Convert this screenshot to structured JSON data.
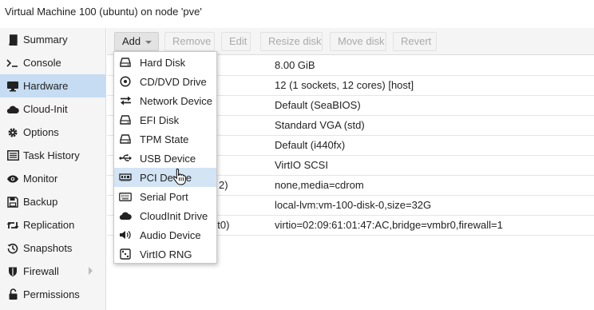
{
  "window": {
    "title": "Virtual Machine 100 (ubuntu) on node 'pve'"
  },
  "sidebar": {
    "items": [
      {
        "label": "Summary",
        "icon": "book-icon"
      },
      {
        "label": "Console",
        "icon": "terminal-icon"
      },
      {
        "label": "Hardware",
        "icon": "desktop-icon",
        "active": true
      },
      {
        "label": "Cloud-Init",
        "icon": "cloud-icon"
      },
      {
        "label": "Options",
        "icon": "gear-icon"
      },
      {
        "label": "Task History",
        "icon": "list-icon"
      },
      {
        "label": "Monitor",
        "icon": "eye-icon"
      },
      {
        "label": "Backup",
        "icon": "floppy-icon"
      },
      {
        "label": "Replication",
        "icon": "retweet-icon"
      },
      {
        "label": "Snapshots",
        "icon": "history-icon"
      },
      {
        "label": "Firewall",
        "icon": "shield-icon",
        "has_submenu": true
      },
      {
        "label": "Permissions",
        "icon": "unlock-icon"
      }
    ]
  },
  "toolbar": {
    "add_label": "Add",
    "remove_label": "Remove",
    "edit_label": "Edit",
    "resize_label": "Resize disk",
    "move_label": "Move disk",
    "revert_label": "Revert"
  },
  "hardware": {
    "rows": [
      {
        "key": "",
        "value": "8.00 GiB"
      },
      {
        "key": "",
        "value": "12 (1 sockets, 12 cores) [host]"
      },
      {
        "key": "",
        "value": "Default (SeaBIOS)"
      },
      {
        "key": "",
        "value": "Standard VGA (std)"
      },
      {
        "key": "",
        "value": "Default (i440fx)"
      },
      {
        "key": "",
        "value": "VirtIO SCSI"
      },
      {
        "key": "2)",
        "value": "none,media=cdrom"
      },
      {
        "key": "",
        "value": "local-lvm:vm-100-disk-0,size=32G"
      },
      {
        "key": "et0)",
        "value": "virtio=02:09:61:01:47:AC,bridge=vmbr0,firewall=1"
      }
    ]
  },
  "add_menu": {
    "items": [
      {
        "label": "Hard Disk",
        "icon": "hdd-icon"
      },
      {
        "label": "CD/DVD Drive",
        "icon": "cdrom-icon"
      },
      {
        "label": "Network Device",
        "icon": "exchange-icon"
      },
      {
        "label": "EFI Disk",
        "icon": "hdd-icon"
      },
      {
        "label": "TPM State",
        "icon": "hdd-icon"
      },
      {
        "label": "USB Device",
        "icon": "usb-icon"
      },
      {
        "label": "PCI Device",
        "icon": "pci-card-icon",
        "hover": true
      },
      {
        "label": "Serial Port",
        "icon": "keyboard-icon"
      },
      {
        "label": "CloudInit Drive",
        "icon": "cloud-icon"
      },
      {
        "label": "Audio Device",
        "icon": "volume-icon"
      },
      {
        "label": "VirtIO RNG",
        "icon": "dice-icon"
      }
    ]
  },
  "colors": {
    "sidebar_bg": "#f5f5f5",
    "active_bg": "#c5dcf2",
    "menu_hover_bg": "#d3e4f4",
    "border": "#dcdcdc"
  }
}
